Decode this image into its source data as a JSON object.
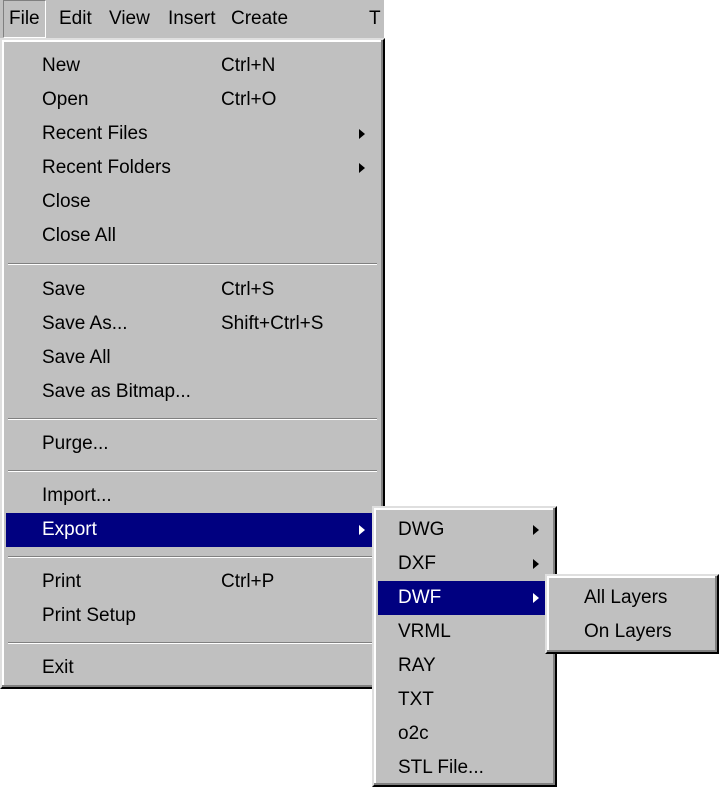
{
  "menubar": {
    "items": [
      {
        "label": "File"
      },
      {
        "label": "Edit"
      },
      {
        "label": "View"
      },
      {
        "label": "Insert"
      },
      {
        "label": "Create"
      },
      {
        "label": "T"
      }
    ]
  },
  "file_menu": {
    "items": [
      {
        "label": "New",
        "shortcut": "Ctrl+N"
      },
      {
        "label": "Open",
        "shortcut": "Ctrl+O"
      },
      {
        "label": "Recent Files"
      },
      {
        "label": "Recent Folders"
      },
      {
        "label": "Close"
      },
      {
        "label": "Close All"
      },
      {
        "label": "Save",
        "shortcut": "Ctrl+S"
      },
      {
        "label": "Save As...",
        "shortcut": "Shift+Ctrl+S"
      },
      {
        "label": "Save All"
      },
      {
        "label": "Save as Bitmap..."
      },
      {
        "label": "Purge..."
      },
      {
        "label": "Import..."
      },
      {
        "label": "Export"
      },
      {
        "label": "Print",
        "shortcut": "Ctrl+P"
      },
      {
        "label": "Print Setup"
      },
      {
        "label": "Exit"
      }
    ]
  },
  "export_menu": {
    "items": [
      {
        "label": "DWG"
      },
      {
        "label": "DXF"
      },
      {
        "label": "DWF"
      },
      {
        "label": "VRML"
      },
      {
        "label": "RAY"
      },
      {
        "label": "TXT"
      },
      {
        "label": "o2c"
      },
      {
        "label": "STL File..."
      }
    ]
  },
  "dwf_menu": {
    "items": [
      {
        "label": "All Layers"
      },
      {
        "label": "On Layers"
      }
    ]
  },
  "colors": {
    "menu_face": "#c0c0c0",
    "highlight": "#000080",
    "highlight_text": "#ffffff"
  }
}
